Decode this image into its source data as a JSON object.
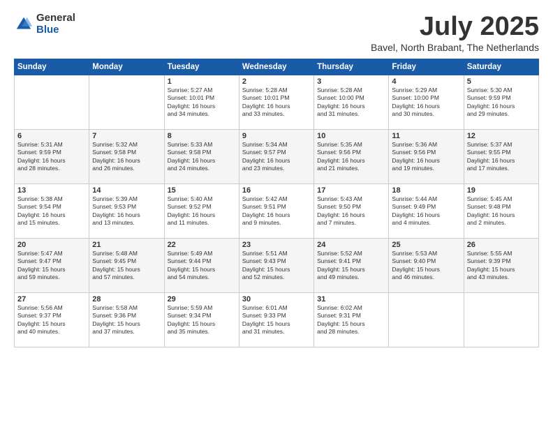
{
  "logo": {
    "general": "General",
    "blue": "Blue"
  },
  "title": "July 2025",
  "subtitle": "Bavel, North Brabant, The Netherlands",
  "days_of_week": [
    "Sunday",
    "Monday",
    "Tuesday",
    "Wednesday",
    "Thursday",
    "Friday",
    "Saturday"
  ],
  "weeks": [
    [
      {
        "day": "",
        "detail": ""
      },
      {
        "day": "",
        "detail": ""
      },
      {
        "day": "1",
        "detail": "Sunrise: 5:27 AM\nSunset: 10:01 PM\nDaylight: 16 hours\nand 34 minutes."
      },
      {
        "day": "2",
        "detail": "Sunrise: 5:28 AM\nSunset: 10:01 PM\nDaylight: 16 hours\nand 33 minutes."
      },
      {
        "day": "3",
        "detail": "Sunrise: 5:28 AM\nSunset: 10:00 PM\nDaylight: 16 hours\nand 31 minutes."
      },
      {
        "day": "4",
        "detail": "Sunrise: 5:29 AM\nSunset: 10:00 PM\nDaylight: 16 hours\nand 30 minutes."
      },
      {
        "day": "5",
        "detail": "Sunrise: 5:30 AM\nSunset: 9:59 PM\nDaylight: 16 hours\nand 29 minutes."
      }
    ],
    [
      {
        "day": "6",
        "detail": "Sunrise: 5:31 AM\nSunset: 9:59 PM\nDaylight: 16 hours\nand 28 minutes."
      },
      {
        "day": "7",
        "detail": "Sunrise: 5:32 AM\nSunset: 9:58 PM\nDaylight: 16 hours\nand 26 minutes."
      },
      {
        "day": "8",
        "detail": "Sunrise: 5:33 AM\nSunset: 9:58 PM\nDaylight: 16 hours\nand 24 minutes."
      },
      {
        "day": "9",
        "detail": "Sunrise: 5:34 AM\nSunset: 9:57 PM\nDaylight: 16 hours\nand 23 minutes."
      },
      {
        "day": "10",
        "detail": "Sunrise: 5:35 AM\nSunset: 9:56 PM\nDaylight: 16 hours\nand 21 minutes."
      },
      {
        "day": "11",
        "detail": "Sunrise: 5:36 AM\nSunset: 9:56 PM\nDaylight: 16 hours\nand 19 minutes."
      },
      {
        "day": "12",
        "detail": "Sunrise: 5:37 AM\nSunset: 9:55 PM\nDaylight: 16 hours\nand 17 minutes."
      }
    ],
    [
      {
        "day": "13",
        "detail": "Sunrise: 5:38 AM\nSunset: 9:54 PM\nDaylight: 16 hours\nand 15 minutes."
      },
      {
        "day": "14",
        "detail": "Sunrise: 5:39 AM\nSunset: 9:53 PM\nDaylight: 16 hours\nand 13 minutes."
      },
      {
        "day": "15",
        "detail": "Sunrise: 5:40 AM\nSunset: 9:52 PM\nDaylight: 16 hours\nand 11 minutes."
      },
      {
        "day": "16",
        "detail": "Sunrise: 5:42 AM\nSunset: 9:51 PM\nDaylight: 16 hours\nand 9 minutes."
      },
      {
        "day": "17",
        "detail": "Sunrise: 5:43 AM\nSunset: 9:50 PM\nDaylight: 16 hours\nand 7 minutes."
      },
      {
        "day": "18",
        "detail": "Sunrise: 5:44 AM\nSunset: 9:49 PM\nDaylight: 16 hours\nand 4 minutes."
      },
      {
        "day": "19",
        "detail": "Sunrise: 5:45 AM\nSunset: 9:48 PM\nDaylight: 16 hours\nand 2 minutes."
      }
    ],
    [
      {
        "day": "20",
        "detail": "Sunrise: 5:47 AM\nSunset: 9:47 PM\nDaylight: 15 hours\nand 59 minutes."
      },
      {
        "day": "21",
        "detail": "Sunrise: 5:48 AM\nSunset: 9:45 PM\nDaylight: 15 hours\nand 57 minutes."
      },
      {
        "day": "22",
        "detail": "Sunrise: 5:49 AM\nSunset: 9:44 PM\nDaylight: 15 hours\nand 54 minutes."
      },
      {
        "day": "23",
        "detail": "Sunrise: 5:51 AM\nSunset: 9:43 PM\nDaylight: 15 hours\nand 52 minutes."
      },
      {
        "day": "24",
        "detail": "Sunrise: 5:52 AM\nSunset: 9:41 PM\nDaylight: 15 hours\nand 49 minutes."
      },
      {
        "day": "25",
        "detail": "Sunrise: 5:53 AM\nSunset: 9:40 PM\nDaylight: 15 hours\nand 46 minutes."
      },
      {
        "day": "26",
        "detail": "Sunrise: 5:55 AM\nSunset: 9:39 PM\nDaylight: 15 hours\nand 43 minutes."
      }
    ],
    [
      {
        "day": "27",
        "detail": "Sunrise: 5:56 AM\nSunset: 9:37 PM\nDaylight: 15 hours\nand 40 minutes."
      },
      {
        "day": "28",
        "detail": "Sunrise: 5:58 AM\nSunset: 9:36 PM\nDaylight: 15 hours\nand 37 minutes."
      },
      {
        "day": "29",
        "detail": "Sunrise: 5:59 AM\nSunset: 9:34 PM\nDaylight: 15 hours\nand 35 minutes."
      },
      {
        "day": "30",
        "detail": "Sunrise: 6:01 AM\nSunset: 9:33 PM\nDaylight: 15 hours\nand 31 minutes."
      },
      {
        "day": "31",
        "detail": "Sunrise: 6:02 AM\nSunset: 9:31 PM\nDaylight: 15 hours\nand 28 minutes."
      },
      {
        "day": "",
        "detail": ""
      },
      {
        "day": "",
        "detail": ""
      }
    ]
  ]
}
